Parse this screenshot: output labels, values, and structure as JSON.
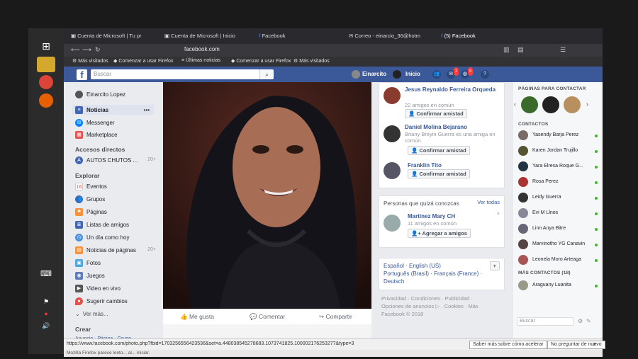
{
  "tabs": [
    {
      "label": "Cuenta de Microsoft | Tu pr"
    },
    {
      "label": "Cuenta de Microsoft | Inicio"
    },
    {
      "label": "Facebook"
    },
    {
      "label": "Correo - einarcio_36@hotm"
    },
    {
      "label": "(5) Facebook"
    }
  ],
  "url": "facebook.com",
  "bookmarks": [
    "Más visitados",
    "Comenzar a usar Firefox",
    "Últimas noticias",
    "Comenzar a usar Firefox",
    "Más visitados"
  ],
  "header": {
    "search_placeholder": "Buscar",
    "user_name": "Einarcito",
    "home_label": "Inicio",
    "messages_badge": "2",
    "notif_badge": "5"
  },
  "leftnav": {
    "profile_name": "Einarcito Lopez",
    "items_top": [
      {
        "label": "Noticias"
      },
      {
        "label": "Messenger"
      },
      {
        "label": "Marketplace"
      }
    ],
    "shortcuts_title": "Accesos directos",
    "shortcut": {
      "label": "AUTOS CHUTOS ...",
      "count": "20+"
    },
    "explore_title": "Explorar",
    "explore": [
      {
        "label": "Eventos"
      },
      {
        "label": "Grupos"
      },
      {
        "label": "Páginas"
      },
      {
        "label": "Listas de amigos"
      },
      {
        "label": "Un día como hoy"
      },
      {
        "label": "Noticias de páginas",
        "count": "20+"
      },
      {
        "label": "Fotos"
      },
      {
        "label": "Juegos"
      },
      {
        "label": "Video en vivo"
      },
      {
        "label": "Sugerir cambios"
      }
    ],
    "see_more": "Ver más...",
    "create_title": "Crear",
    "create_links": "Anuncio · Página · Grupo"
  },
  "photo_actions": {
    "like": "Me gusta",
    "comment": "Comentar",
    "share": "Compartir"
  },
  "requests": [
    {
      "name": "Jesus Reynaldo Ferreira Orqueda",
      "sub": "22 amigos en común",
      "btn": "Confirmar amistad"
    },
    {
      "name": "Daniel Molina Bejarano",
      "sub": "Briany Breyin Guerra es una amiga en común.",
      "btn": "Confirmar amistad"
    },
    {
      "name": "Franklin Tito",
      "sub": "",
      "btn": "Confirmar amistad"
    }
  ],
  "pymk": {
    "title": "Personas que quizá conozcas",
    "see_all": "Ver todas",
    "name": "Martinez Mary CH",
    "sub": "11 amigos en común",
    "btn": "Agregar a amigos"
  },
  "languages": {
    "line1": "Español · English (US)",
    "line2": "Português (Brasil) · Français (France) ·",
    "line3": "Deutsch"
  },
  "footer": {
    "line1": "Privacidad · Condiciones · Publicidad ·",
    "line2": "Opciones de anuncios ▷ · Cookies · Más ·",
    "line3": "Facebook © 2018"
  },
  "right": {
    "pages_title": "PÁGINAS PARA CONTACTAR",
    "contacts_title": "CONTACTOS",
    "contacts": [
      {
        "name": "Yasendy Barja Perez"
      },
      {
        "name": "Karen Jordan Trujillo"
      },
      {
        "name": "Yara Elresa Roque G..."
      },
      {
        "name": "Rosa Perez"
      },
      {
        "name": "Leidy Guerra"
      },
      {
        "name": "Evi M Llnos"
      },
      {
        "name": "Linn Anya Bitre"
      },
      {
        "name": "Marvinotho YG Canavin"
      },
      {
        "name": "Leonela Moro Arteaga"
      }
    ],
    "more_title": "MÁS CONTACTOS (18)",
    "more_contact": "Araguany Luanita",
    "search_placeholder": "Buscar"
  },
  "statusbar": {
    "url": "https://www.facebook.com/photo.php?fbid=1703256556423536&set=a.448038545278683.1073741825.100002176253277&type=3",
    "learn_more": "Saber más sobre cómo acelerar",
    "dont_ask": "No preguntar de nuevo"
  },
  "notify": "Mozilla Firefox parece lento... al... iniciar."
}
